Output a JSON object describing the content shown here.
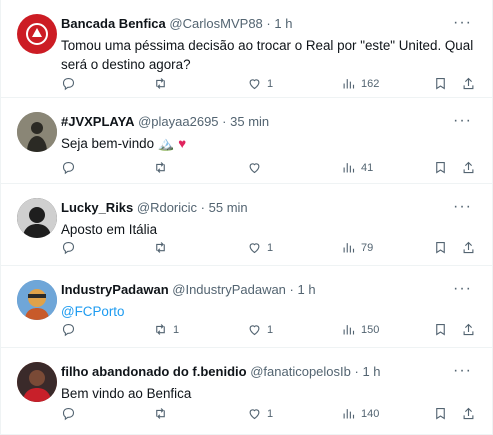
{
  "tweets": [
    {
      "name": "Bancada Benfica",
      "handle": "@CarlosMVP88",
      "dot": "·",
      "time": "1 h",
      "text": "Tomou uma péssima decisão ao trocar o Real por \"este\" United. Qual será o destino agora?",
      "replies": "",
      "retweets": "",
      "likes": "1",
      "views": "162"
    },
    {
      "name": "#JVXPLAYA",
      "handle": "@playaa2695",
      "dot": "·",
      "time": "35 min",
      "text": "Seja bem-vindo",
      "emoji": "🏔️",
      "heart": "♥",
      "replies": "",
      "retweets": "",
      "likes": "",
      "views": "41"
    },
    {
      "name": "Lucky_Riks",
      "handle": "@Rdoricic",
      "dot": "·",
      "time": "55 min",
      "text": "Aposto em Itália",
      "replies": "",
      "retweets": "",
      "likes": "1",
      "views": "79"
    },
    {
      "name": "IndustryPadawan",
      "handle": "@IndustryPadawan",
      "dot": "·",
      "time": "1 h",
      "text": "@FCPorto",
      "replies": "",
      "retweets": "1",
      "likes": "1",
      "views": "150"
    },
    {
      "name": "filho abandonado do f.benidio",
      "handle": "@fanaticopelosIb",
      "dot": "·",
      "time": "1 h",
      "text": "Bem vindo ao Benfica",
      "replies": "",
      "retweets": "",
      "likes": "1",
      "views": "140"
    }
  ],
  "more_label": "···",
  "colors": {
    "accent": "#1d9bf0",
    "text": "#0f1419",
    "muted": "#536471",
    "heart": "#e0245e"
  },
  "icons": [
    "reply-icon",
    "retweet-icon",
    "like-icon",
    "views-icon",
    "bookmark-icon",
    "share-icon",
    "more-icon"
  ]
}
